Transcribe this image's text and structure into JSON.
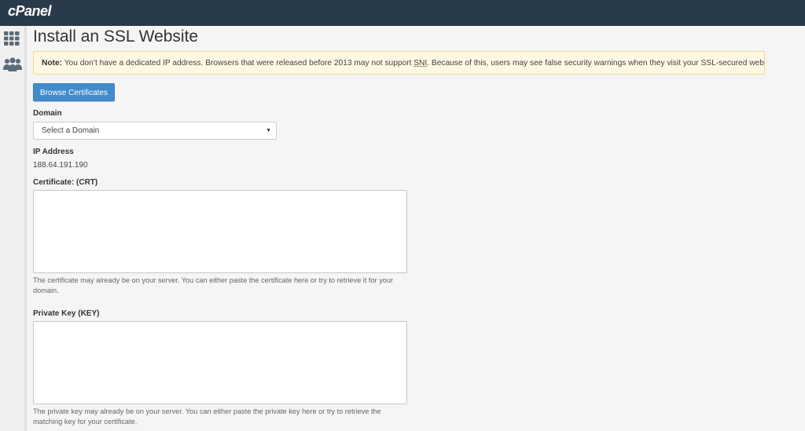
{
  "header": {
    "logo_text": "cPanel"
  },
  "sidebar": {
    "items": [
      {
        "icon": "grid-icon"
      },
      {
        "icon": "users-icon"
      }
    ]
  },
  "page": {
    "title": "Install an SSL Website",
    "note": {
      "label": "Note:",
      "text_before": "You don’t have a dedicated IP address. Browsers that were released before 2013 may not support ",
      "sni": "SNI",
      "text_after": ". Because of this, users may see false security warnings when they visit your SSL-secured websites."
    },
    "browse_button": "Browse Certificates",
    "domain": {
      "label": "Domain",
      "selected": "Select a Domain",
      "caret": "▼"
    },
    "ip": {
      "label": "IP Address",
      "value": "188.64.191.190"
    },
    "certificate": {
      "label": "Certificate: (CRT)",
      "value": "",
      "help": "The certificate may already be on your server. You can either paste the certificate here or try to retrieve it for your domain."
    },
    "private_key": {
      "label": "Private Key (KEY)",
      "value": "",
      "help": "The private key may already be on your server. You can either paste the private key here or try to retrieve the matching key for your certificate."
    }
  },
  "colors": {
    "topbar": "#293a4a",
    "button": "#428bca",
    "note_bg": "#fcf8e3",
    "note_border": "#f0d78f"
  }
}
